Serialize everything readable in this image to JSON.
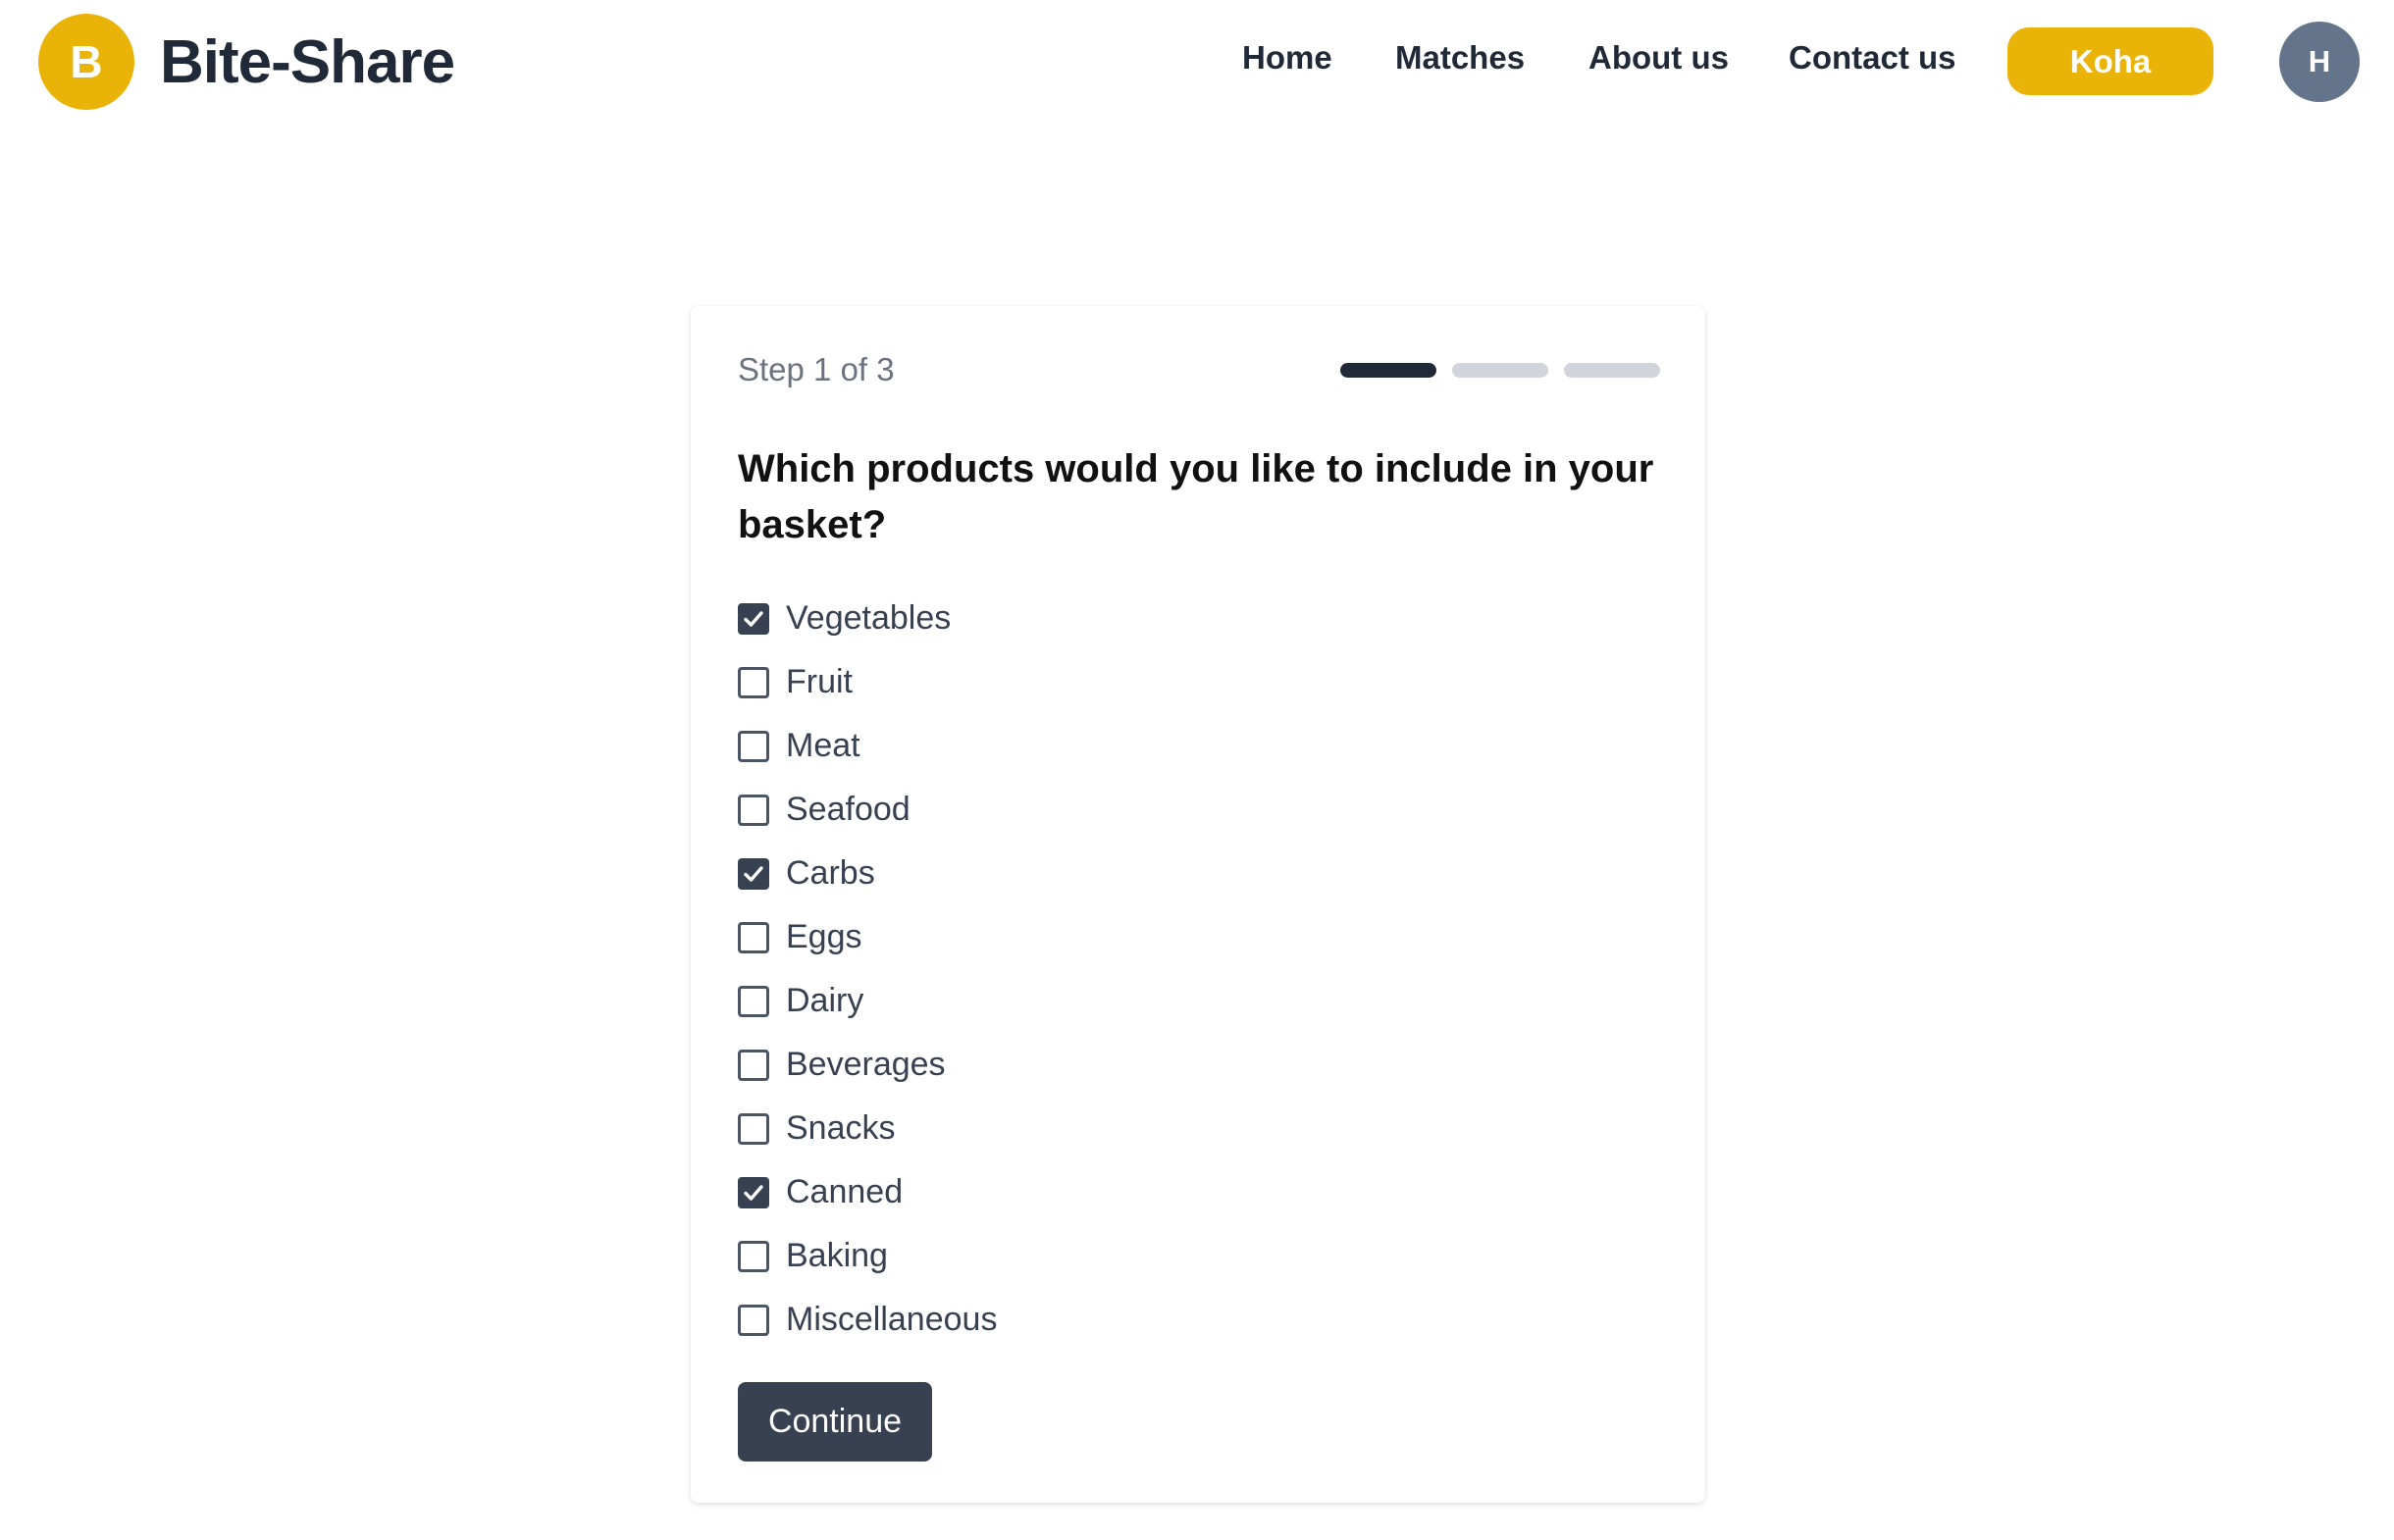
{
  "brand": {
    "badge_letter": "B",
    "name": "Bite-Share",
    "accent_color": "#eab308"
  },
  "nav": {
    "links": [
      {
        "label": "Home"
      },
      {
        "label": "Matches"
      },
      {
        "label": "About us"
      },
      {
        "label": "Contact us"
      }
    ],
    "koha_label": "Koha",
    "avatar_initial": "H"
  },
  "wizard": {
    "step_label": "Step 1 of 3",
    "current_step": 1,
    "total_steps": 3,
    "question": "Which products would you like to include in your basket?",
    "options": [
      {
        "label": "Vegetables",
        "checked": true
      },
      {
        "label": "Fruit",
        "checked": false
      },
      {
        "label": "Meat",
        "checked": false
      },
      {
        "label": "Seafood",
        "checked": false
      },
      {
        "label": "Carbs",
        "checked": true
      },
      {
        "label": "Eggs",
        "checked": false
      },
      {
        "label": "Dairy",
        "checked": false
      },
      {
        "label": "Beverages",
        "checked": false
      },
      {
        "label": "Snacks",
        "checked": false
      },
      {
        "label": "Canned",
        "checked": true
      },
      {
        "label": "Baking",
        "checked": false
      },
      {
        "label": "Miscellaneous",
        "checked": false
      }
    ],
    "continue_label": "Continue"
  }
}
